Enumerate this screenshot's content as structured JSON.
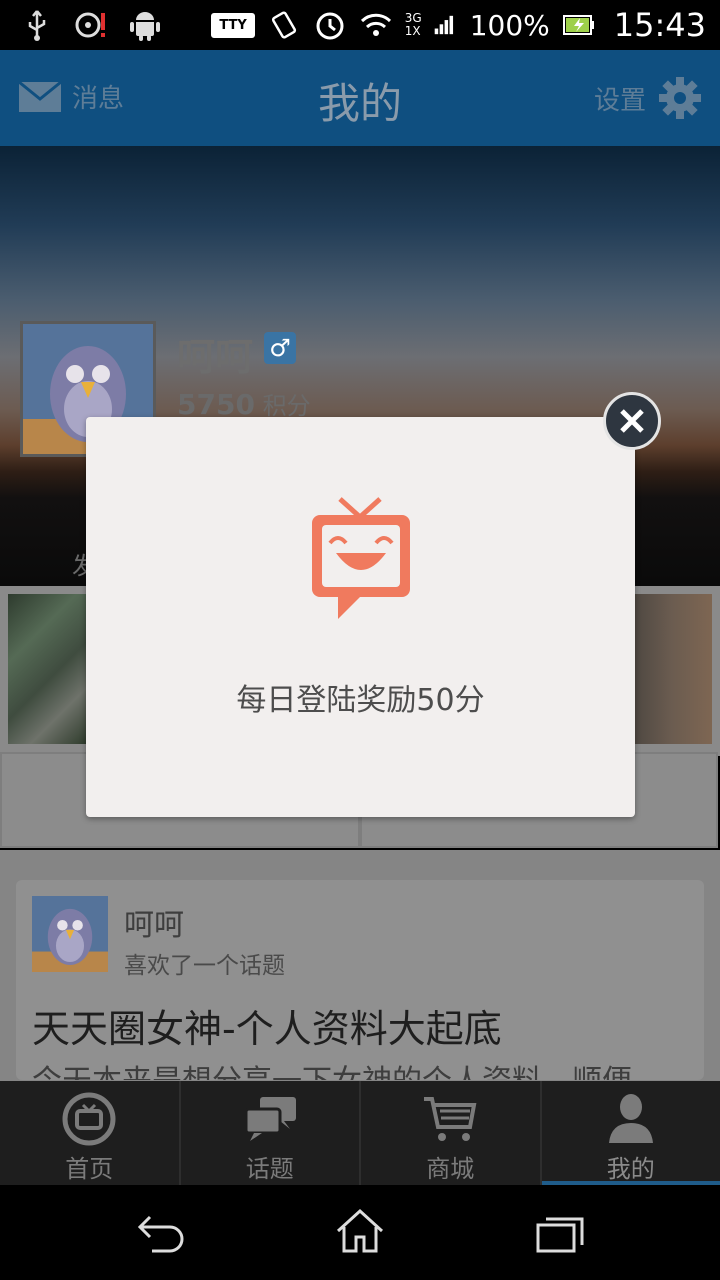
{
  "status_bar": {
    "tty": "TTY",
    "network": "3G",
    "network_alt": "1X",
    "battery": "100%",
    "time": "15:43"
  },
  "header": {
    "left_label": "消息",
    "title": "我的",
    "right_label": "设置"
  },
  "profile": {
    "name": "呵呵",
    "gender_badge": "♂",
    "points_value": "5750",
    "points_unit": "积分",
    "stub_label": "发"
  },
  "feed": {
    "user": "呵呵",
    "action": "喜欢了一个话题",
    "title": "天天圈女神-个人资料大起底",
    "excerpt": "今天本来是想分享一下女神的个人资料，顺便"
  },
  "bottom_nav": {
    "items": [
      {
        "label": "首页",
        "icon": "tv-home-icon",
        "active": false
      },
      {
        "label": "话题",
        "icon": "chat-bubbles-icon",
        "active": false
      },
      {
        "label": "商城",
        "icon": "cart-icon",
        "active": false
      },
      {
        "label": "我的",
        "icon": "person-icon",
        "active": true
      }
    ]
  },
  "modal": {
    "message": "每日登陆奖励50分",
    "icon": "smiling-tv-icon",
    "close_icon": "close-icon"
  },
  "colors": {
    "header_bg": "#0f4f80",
    "modal_bg": "#f2efee",
    "modal_icon": "#f07a5e",
    "active_tab_indicator": "#1f5c8a"
  }
}
